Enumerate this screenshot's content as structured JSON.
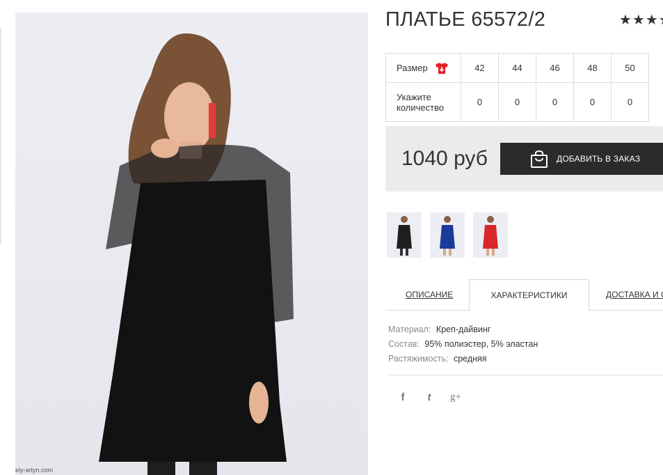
{
  "product": {
    "title": "ПЛАТЬЕ 65572/2",
    "rating_stars": "★★★★"
  },
  "photo": {
    "watermark": "ely-artyn.com"
  },
  "size_table": {
    "size_label": "Размер",
    "qty_label": "Укажите количество",
    "sizes": [
      "42",
      "44",
      "46",
      "48",
      "50"
    ],
    "quantities": [
      "0",
      "0",
      "0",
      "0",
      "0"
    ]
  },
  "price_box": {
    "price": "1040 руб",
    "add_button_label": "ДОБАВИТЬ В ЗАКАЗ"
  },
  "thumbnails": [
    {
      "color": "#1f1f1f"
    },
    {
      "color": "#1b3b9a"
    },
    {
      "color": "#d9262b"
    }
  ],
  "tabs": [
    {
      "label": "ОПИСАНИЕ"
    },
    {
      "label": "ХАРАКТЕРИСТИКИ"
    },
    {
      "label": "ДОСТАВКА И О"
    }
  ],
  "characteristics": [
    {
      "key": "Материал:",
      "value": "Креп-дайвинг"
    },
    {
      "key": "Состав:",
      "value": "95% полиэстер, 5% эластан"
    },
    {
      "key": "Растяжимость:",
      "value": "средняя"
    }
  ],
  "social": {
    "facebook": "f",
    "twitter": "t",
    "googleplus": "g+"
  },
  "colors": {
    "accent_dark": "#2b2b2b",
    "tshirt_red": "#e5202b"
  }
}
